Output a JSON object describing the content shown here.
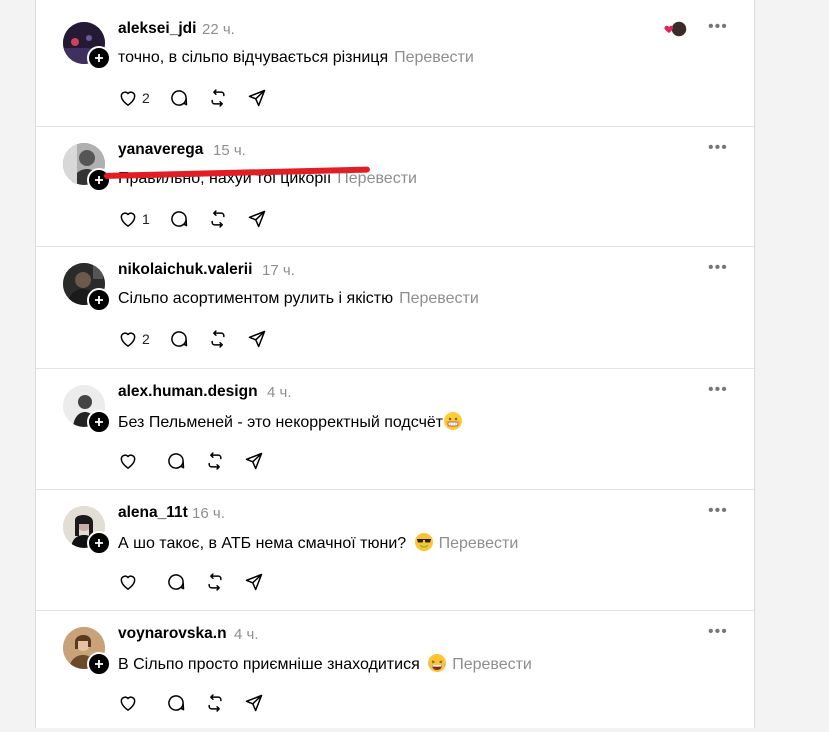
{
  "comments": [
    {
      "username": "aleksei_jdi",
      "time": "22 ч.",
      "text": "точно, в сільпо відчувається різниця",
      "translate": "Перевести",
      "likes": "2",
      "colors": {
        "avatar": "#2a1f3a"
      }
    },
    {
      "username": "yanaverega",
      "time": "15 ч.",
      "text": "Правильно, нахуй тоі цикорії",
      "translate": "Перевести",
      "likes": "1",
      "colors": {
        "avatar": "#9a9a9a"
      }
    },
    {
      "username": "nikolaichuk.valerii",
      "time": "17 ч.",
      "text": "Сільпо асортиментом рулить і якістю",
      "translate": "Перевести",
      "likes": "2",
      "colors": {
        "avatar": "#3a3a3a"
      }
    },
    {
      "username": "alex.human.design",
      "time": "4 ч.",
      "text": "Без Пельменей - это некорректный подсчёт",
      "translate": "",
      "likes": "",
      "colors": {
        "avatar": "#e8e8e8"
      }
    },
    {
      "username": "alena_11t",
      "time": "16 ч.",
      "text": "А шо такоє, в АТБ нема смачної тюни?",
      "translate": "Перевести",
      "likes": "",
      "colors": {
        "avatar": "#d9d2c8"
      }
    },
    {
      "username": "voynarovska.n",
      "time": "4 ч.",
      "text": "В Сільпо просто приємніше знаходитися",
      "translate": "Перевести",
      "likes": "",
      "colors": {
        "avatar": "#b38a62"
      }
    }
  ],
  "more_label": "•••",
  "icons": [
    "heart-icon",
    "comment-icon",
    "repost-icon",
    "share-icon",
    "follow-plus-icon",
    "more-icon"
  ]
}
